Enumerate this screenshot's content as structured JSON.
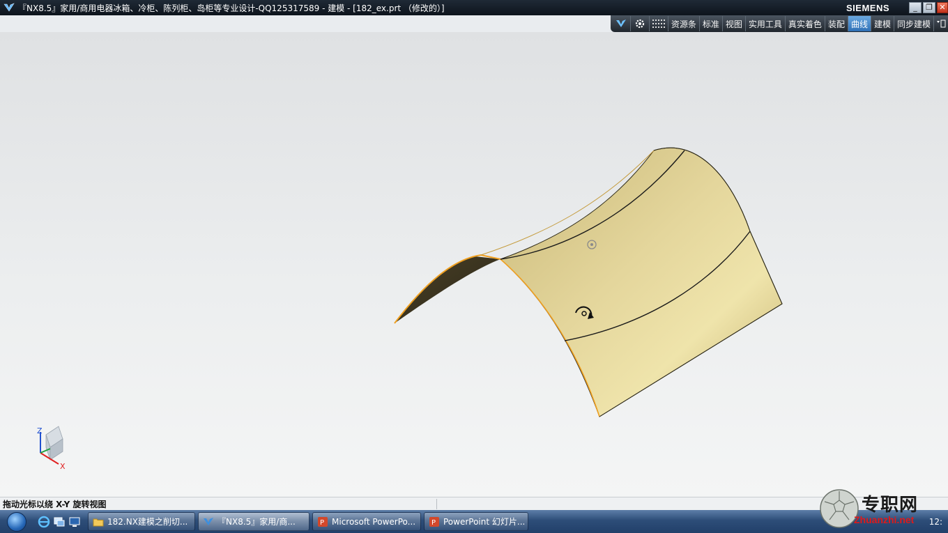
{
  "window": {
    "title": "『NX8.5』家用/商用电器冰箱、冷柜、陈列柜、岛柜等专业设计-QQ125317589 - 建模 - [182_ex.prt （修改的）]",
    "brand": "SIEMENS",
    "min_label": "_",
    "max_label": "❐",
    "close_label": "✕"
  },
  "toolbar": {
    "tabs": [
      {
        "label": "资源条"
      },
      {
        "label": "标准"
      },
      {
        "label": "视图"
      },
      {
        "label": "实用工具"
      },
      {
        "label": "真实着色"
      },
      {
        "label": "装配"
      },
      {
        "label": "曲线",
        "active": true
      },
      {
        "label": "建模"
      },
      {
        "label": "同步建模"
      }
    ]
  },
  "triad": {
    "z_label": "Z",
    "x_label": "X"
  },
  "colors": {
    "surface": "#d9c98a",
    "edge_highlight": "#f0a020",
    "active_tab": "#3f82c8"
  },
  "status": {
    "text": "拖动光标以绕 X-Y 旋转视图"
  },
  "taskbar": {
    "items": [
      {
        "label": "182.NX建模之削切...",
        "icon": "folder-icon"
      },
      {
        "label": "『NX8.5』家用/商...",
        "icon": "nx-icon",
        "active": true
      },
      {
        "label": "Microsoft PowerPo...",
        "icon": "powerpoint-icon"
      },
      {
        "label": "PowerPoint 幻灯片...",
        "icon": "powerpoint-icon"
      }
    ],
    "clock": "12:"
  },
  "watermark": {
    "cn": "专职网",
    "en": "Zhuanzhi.net"
  }
}
